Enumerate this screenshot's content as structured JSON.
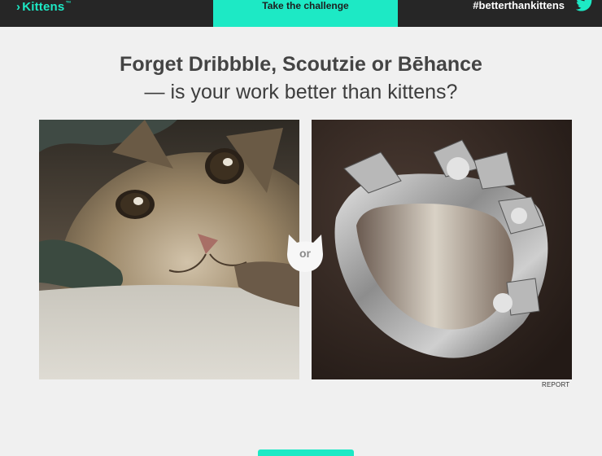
{
  "header": {
    "logo_text": "Kittens",
    "logo_tm": "™",
    "logo_chevron": "›",
    "challenge_label": "Take the challenge",
    "hashtag": "#betterthankittens",
    "twitter_icon": "twitter-bird-icon"
  },
  "main": {
    "headline_line1": "Forget Dribbble, Scoutzie or Bēhance",
    "headline_line2": "— is your work better than kittens?",
    "left_image": "kitten-photo",
    "right_image": "silver-cuff-bracelet-photo",
    "or_label": "or",
    "report_label": "REPORT"
  },
  "colors": {
    "accent": "#1de9c5",
    "topbar": "#262626",
    "page_bg": "#f0f0f0"
  }
}
